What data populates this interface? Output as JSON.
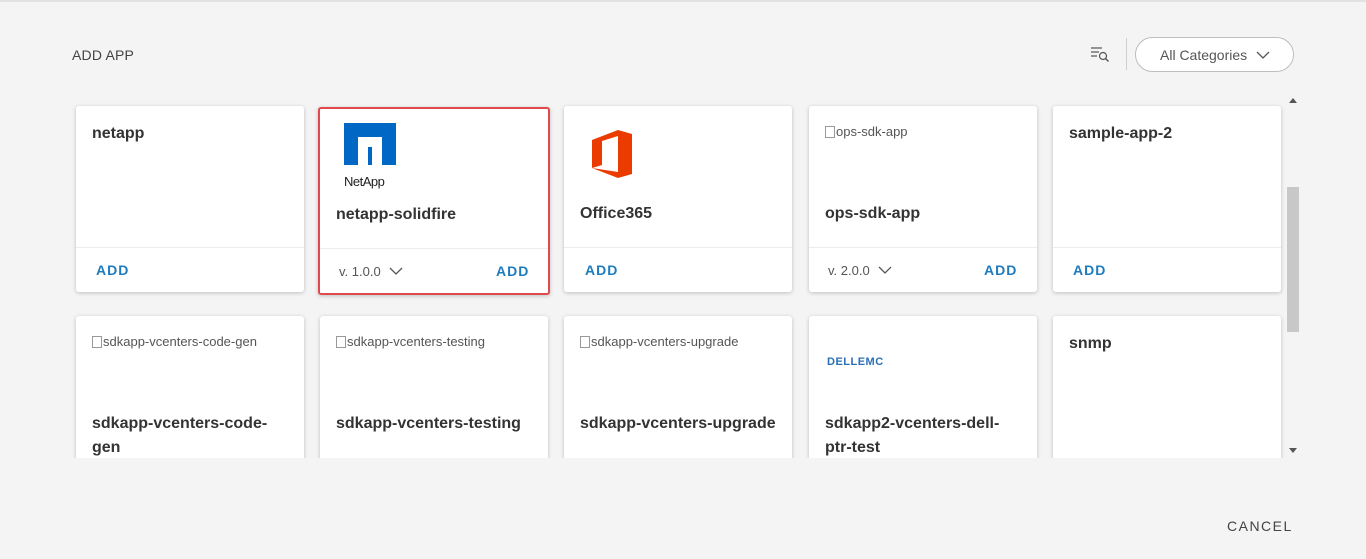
{
  "header": {
    "title": "ADD APP",
    "filter_icon": "filter-search-icon",
    "category_value": "All Categories"
  },
  "cards": [
    {
      "name": "netapp",
      "add_label": "ADD"
    },
    {
      "name": "netapp-solidfire",
      "logo_text": "NetApp",
      "version": "v. 1.0.0",
      "add_label": "ADD"
    },
    {
      "name": "Office365",
      "add_label": "ADD"
    },
    {
      "name": "ops-sdk-app",
      "image_alt": "ops-sdk-app",
      "version": "v. 2.0.0",
      "add_label": "ADD"
    },
    {
      "name": "sample-app-2",
      "add_label": "ADD"
    },
    {
      "name": "sdkapp-vcenters-code-gen",
      "image_alt": "sdkapp-vcenters-code-gen"
    },
    {
      "name": "sdkapp-vcenters-testing",
      "image_alt": "sdkapp-vcenters-testing"
    },
    {
      "name": "sdkapp-vcenters-upgrade",
      "image_alt": "sdkapp-vcenters-upgrade"
    },
    {
      "name": "sdkapp2-vcenters-dell-ptr-test",
      "logo_text": "DELLEMC"
    },
    {
      "name": "snmp"
    }
  ],
  "colors": {
    "accent": "#1d7bbf",
    "selected_border": "#e0494d",
    "netapp_blue": "#0067c5",
    "office_red": "#eb3c00"
  },
  "footer": {
    "cancel_label": "CANCEL"
  }
}
